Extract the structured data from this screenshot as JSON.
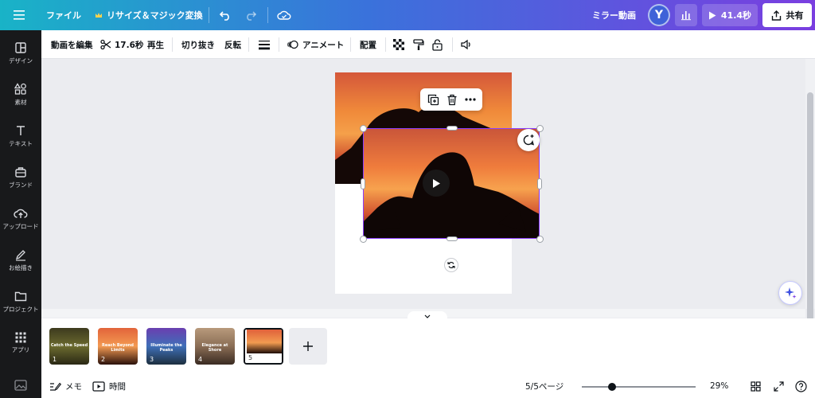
{
  "topbar": {
    "file_label": "ファイル",
    "resize_label": "リサイズ＆マジック変換",
    "mirror_label": "ミラー動画",
    "avatar_initial": "Y",
    "play_label": "41.4秒",
    "share_label": "共有"
  },
  "sidebar": {
    "items": [
      {
        "label": "デザイン",
        "icon": "layout-icon"
      },
      {
        "label": "素材",
        "icon": "shapes-icon"
      },
      {
        "label": "テキスト",
        "icon": "text-icon"
      },
      {
        "label": "ブランド",
        "icon": "brand-icon"
      },
      {
        "label": "アップロード",
        "icon": "upload-icon"
      },
      {
        "label": "お絵描き",
        "icon": "draw-icon"
      },
      {
        "label": "プロジェクト",
        "icon": "folder-icon"
      },
      {
        "label": "アプリ",
        "icon": "apps-icon"
      }
    ]
  },
  "toolbar": {
    "edit_video": "動画を編集",
    "duration": "17.6秒",
    "playback": "再生",
    "crop": "切り抜き",
    "flip": "反転",
    "animate": "アニメート",
    "position": "配置"
  },
  "timeline": {
    "pages": [
      {
        "title": "Catch the Speed",
        "num": "1",
        "colors": [
          "#3d3a1e",
          "#6b6a2f",
          "#2a2814"
        ]
      },
      {
        "title": "Reach Beyond Limits",
        "num": "2",
        "colors": [
          "#e2643a",
          "#f39a52",
          "#2b110b"
        ]
      },
      {
        "title": "Illuminate the Peaks",
        "num": "3",
        "colors": [
          "#6a3fb0",
          "#3f6fb8",
          "#1d2f3f"
        ]
      },
      {
        "title": "Elegance at Shore",
        "num": "4",
        "colors": [
          "#b89a7c",
          "#8a6d55",
          "#3a2b22"
        ]
      },
      {
        "title": "",
        "num": "5",
        "colors": [
          "#e0603a",
          "#f29b50",
          "#1d0c08"
        ]
      }
    ]
  },
  "bottombar": {
    "notes_label": "メモ",
    "time_label": "時間",
    "page_indicator": "5/5ページ",
    "zoom_label": "29%",
    "zoom_value": 29
  }
}
